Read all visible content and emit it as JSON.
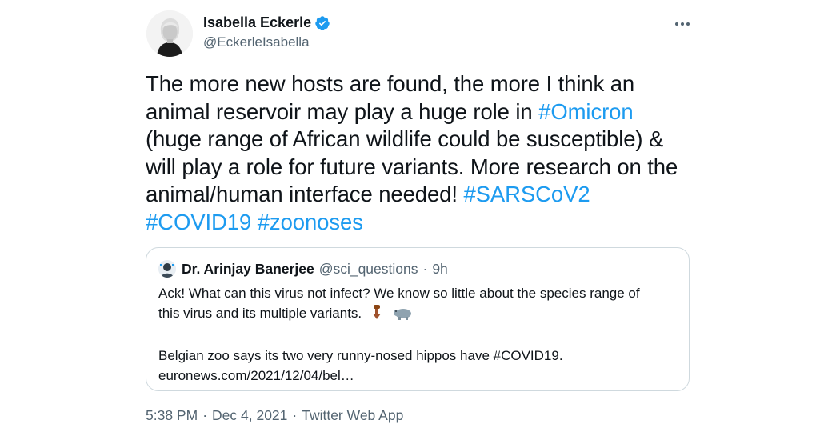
{
  "tweet": {
    "author": {
      "name": "Isabella Eckerle",
      "handle": "@EckerleIsabella",
      "verified": true
    },
    "text_lines": [
      [
        "The more new hosts are found, the more I think  an"
      ],
      [
        "animal reservoir may play a huge role in ",
        "#Omicron"
      ],
      [
        "(huge range of African wildlife could be susceptible) &"
      ],
      [
        "will play a role for future variants. More research on the"
      ],
      [
        "animal/human interface needed! ",
        "#SARSCoV2"
      ],
      [
        "#COVID19",
        " ",
        "#zoonoses"
      ]
    ],
    "hashtags": [
      "#Omicron",
      "#SARSCoV2",
      "#COVID19",
      "#zoonoses"
    ],
    "quoted": {
      "name": "Dr. Arinjay Banerjee",
      "handle": "@sci_questions",
      "separator": "·",
      "time": "9h",
      "line1": "Ack! What can this virus not infect? We know so little about the species range of",
      "line2": "this virus and its multiple variants.",
      "line2_emojis": [
        "pointing-down-icon",
        "hippo-icon"
      ],
      "line3": "Belgian zoo says its two very runny-nosed hippos have #COVID19.",
      "line4": "euronews.com/2021/12/04/bel…"
    },
    "time": "5:38 PM",
    "separator": "·",
    "date": "Dec 4, 2021",
    "source": "Twitter Web App"
  },
  "colors": {
    "link": "#1d9bf0",
    "text": "#0f1419",
    "secondary": "#536471",
    "border": "#cfd9de"
  }
}
